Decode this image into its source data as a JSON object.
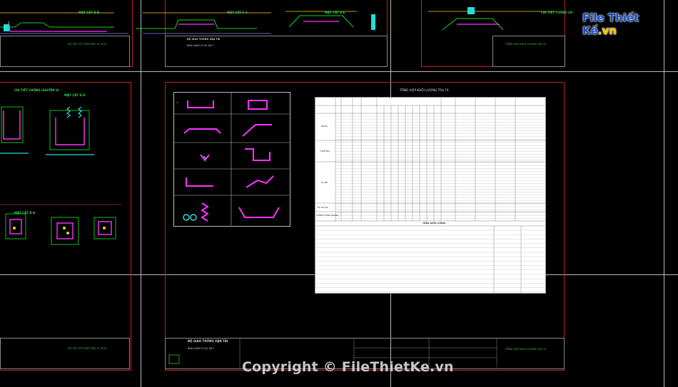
{
  "watermark": "Copyright © FileThietKe.vn",
  "logo": {
    "main": "File Thiết Kế",
    "suffix": ".vn"
  },
  "table": {
    "title": "TỔNG HỢP KHỐI LƯỢNG TRỤ T4",
    "summary_header": "TỔNG KHỐI LƯỢNG",
    "group_labels": [
      "MÓNG",
      "THÂN TRỤ",
      "XÀ MŨ",
      "ĐÁ KÊ GỐI",
      "CHỐNG ĐỘNG NGANG"
    ]
  },
  "sheets": {
    "left_title": "ĐỒ TRÍ CỐT THÉP TRỤ T4 (3/3)",
    "center_note_1": "BỘ GIAO THÔNG VẬN TẢI",
    "center_note_2": "BAN QUẢN LÝ DỰ ÁN 7",
    "right_title": "TỔNG HỢP KHỐI LƯỢNG TRỤ T4",
    "center_bottom_title": "ĐỒ TRÍ CỐT THÉP TRỤ T4 (2/3)",
    "right_bottom_title": "TỔNG HỢP KHỐI LƯỢNG TRỤ T4",
    "left_detail_1": "CHI TIẾT CHỐNG CHUYỂN VỊ",
    "left_detail_2": "MẶT CẮT D-D",
    "left_detail_3": "MẶT CẮT A-A",
    "top_label_1": "MẶT CẮT B-B",
    "top_label_2": "MẶT CẮT C-C",
    "top_label_3": "MẶT CẮT E-E",
    "top_label_4": "CHI TIẾT TƯỜNG CH"
  }
}
